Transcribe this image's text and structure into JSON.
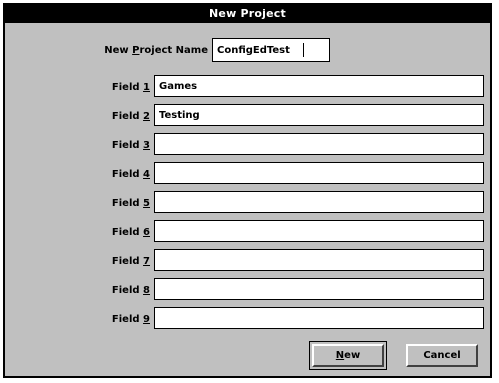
{
  "dialog": {
    "title": "New Project",
    "project_name_label_pre": "New ",
    "project_name_label_key": "P",
    "project_name_label_post": "roject Name",
    "project_name_value": "ConfigEdTest"
  },
  "fields": [
    {
      "label": "Field ",
      "key": "1",
      "value": "Games"
    },
    {
      "label": "Field ",
      "key": "2",
      "value": "Testing"
    },
    {
      "label": "Field ",
      "key": "3",
      "value": ""
    },
    {
      "label": "Field ",
      "key": "4",
      "value": ""
    },
    {
      "label": "Field ",
      "key": "5",
      "value": ""
    },
    {
      "label": "Field ",
      "key": "6",
      "value": ""
    },
    {
      "label": "Field ",
      "key": "7",
      "value": ""
    },
    {
      "label": "Field ",
      "key": "8",
      "value": ""
    },
    {
      "label": "Field ",
      "key": "9",
      "value": ""
    }
  ],
  "buttons": {
    "new_key": "N",
    "new_rest": "ew",
    "cancel_label": "Cancel"
  }
}
